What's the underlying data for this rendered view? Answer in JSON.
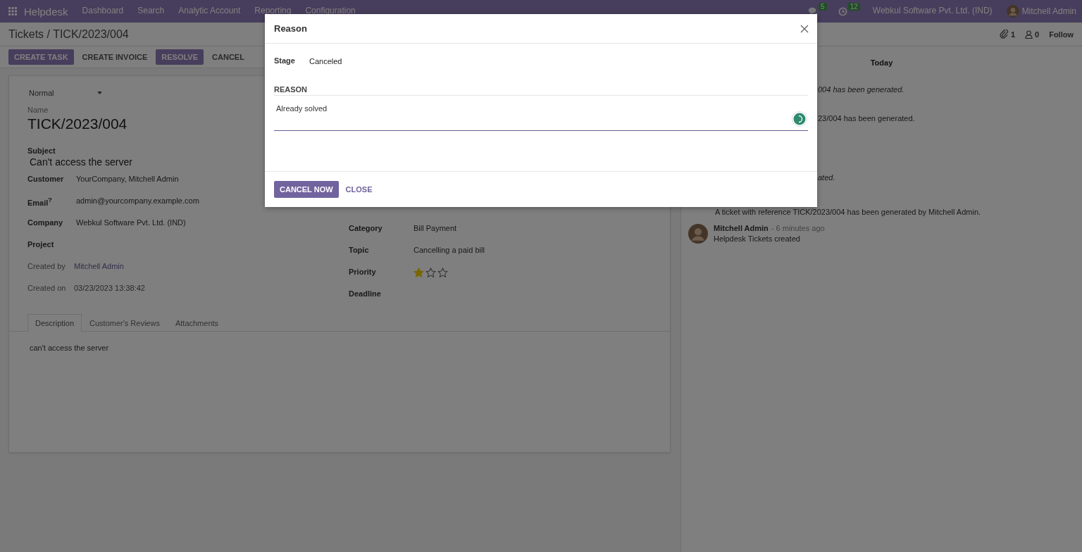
{
  "navbar": {
    "app": "Helpdesk",
    "menu": [
      "Dashboard",
      "Search",
      "Analytic Account",
      "Reporting",
      "Configuration"
    ],
    "messages_count": "5",
    "activities_count": "12",
    "company": "Webkul Software Pvt. Ltd. (IND)",
    "user": "Mitchell Admin"
  },
  "breadcrumb": "Tickets / TICK/2023/004",
  "chatter_bar": {
    "attachments": "1",
    "followers": "0",
    "follow": "Follow"
  },
  "actions": [
    {
      "label": "CREATE TASK",
      "kind": "primary"
    },
    {
      "label": "CREATE INVOICE",
      "kind": "secondary"
    },
    {
      "label": "RESOLVE",
      "kind": "primary"
    },
    {
      "label": "CANCEL",
      "kind": "secondary"
    }
  ],
  "form": {
    "priority_select": "Normal",
    "name_label": "Name",
    "name": "TICK/2023/004",
    "subject_label": "Subject",
    "subject": "Can't access the server",
    "left_fields": [
      {
        "label": "Customer",
        "value": "YourCompany, Mitchell Admin",
        "kind": "plain"
      },
      {
        "label": "Email$^{?}$",
        "value": "admin@yourcompany.example.com",
        "kind": "plain"
      },
      {
        "label": "Company",
        "value": "Webkul Software Pvt. Ltd. (IND)",
        "kind": "plain"
      },
      {
        "label": "Project",
        "kind": "plain"
      },
      {
        "label": "Created by",
        "value": "Mitchell Admin",
        "kind": "link"
      },
      {
        "label": "Created on",
        "value": "03/23/2023 13:38:42",
        "kind": "meta"
      }
    ],
    "right_fields": [
      {
        "label": "Category",
        "value": "Bill Payment",
        "kind": "plain"
      },
      {
        "label": "Topic",
        "value": "Cancelling a paid bill",
        "kind": "plain"
      },
      {
        "label": "Priority",
        "kind": "stars",
        "stars": 1
      },
      {
        "label": "Deadline",
        "kind": "plain"
      }
    ],
    "tabs": [
      {
        "label": "Description",
        "selected": true
      },
      {
        "label": "Customer's Reviews",
        "selected": false
      },
      {
        "label": "Attachments",
        "selected": false
      }
    ],
    "description": "can't access the server"
  },
  "chatter": {
    "date": "Today",
    "messages": [
      {
        "text": "004 has been generated.",
        "italic": true
      },
      {
        "text": "23/004 has been generated.",
        "italic": false
      },
      {
        "text": "ated.",
        "italic": true
      },
      {
        "text": "A ticket with reference TICK/2023/004 has been generated by Mitchell Admin.",
        "italic": false
      }
    ],
    "last": {
      "author": "Mitchell Admin",
      "time": "- 6 minutes ago",
      "body": "Helpdesk Tickets created"
    }
  },
  "dialog": {
    "title": "Reason",
    "stage_label": "Stage",
    "stage": "Canceled",
    "section": "REASON",
    "reason": "Already solved",
    "primary": "CANCEL NOW",
    "secondary": "CLOSE"
  }
}
